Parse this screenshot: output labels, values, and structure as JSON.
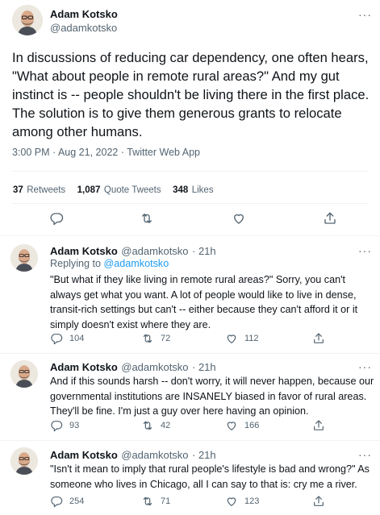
{
  "main_tweet": {
    "author_name": "Adam Kotsko",
    "author_handle": "@adamkotsko",
    "more_label": "···",
    "text": "In discussions of reducing car dependency, one often hears, \"What about people in remote rural areas?\" And my gut instinct is -- people shouldn't be living there in the first place. The solution is to give them generous grants to relocate among other humans.",
    "timestamp": "3:00 PM · Aug 21, 2022 · Twitter Web App",
    "stats": {
      "retweets_count": "37",
      "retweets_label": "Retweets",
      "quotes_count": "1,087",
      "quotes_label": "Quote Tweets",
      "likes_count": "348",
      "likes_label": "Likes"
    },
    "actions": [
      "reply-icon",
      "retweet-icon",
      "like-icon",
      "share-icon"
    ]
  },
  "replies": [
    {
      "author_name": "Adam Kotsko",
      "author_handle": "@adamkotsko",
      "time": "· 21h",
      "more_label": "···",
      "replying_prefix": "Replying to",
      "replying_handle": "@adamkotsko",
      "text": "\"But what if they like living in remote rural areas?\" Sorry, you can't always get what you want. A lot of people would like to live in dense, transit-rich settings but can't -- either because they can't afford it or it simply doesn't exist where they are.",
      "reply_count": "104",
      "retweet_count": "72",
      "like_count": "112"
    },
    {
      "author_name": "Adam Kotsko",
      "author_handle": "@adamkotsko",
      "time": "· 21h",
      "more_label": "···",
      "text": "And if this sounds harsh -- don't worry, it will never happen, because our governmental institutions are INSANELY biased in favor of rural areas. They'll be fine. I'm just a guy over here having an opinion.",
      "reply_count": "93",
      "retweet_count": "42",
      "like_count": "166"
    },
    {
      "author_name": "Adam Kotsko",
      "author_handle": "@adamkotsko",
      "time": "· 21h",
      "more_label": "···",
      "text": "\"Isn't it mean to imply that rural people's lifestyle is bad and wrong?\" As someone who lives in Chicago, all I can say to that is: cry me a river.",
      "reply_count": "254",
      "retweet_count": "71",
      "like_count": "123"
    }
  ],
  "colors": {
    "text": "#0f1419",
    "secondary": "#536471",
    "link": "#1d9bf0",
    "divider": "#eff3f4"
  }
}
